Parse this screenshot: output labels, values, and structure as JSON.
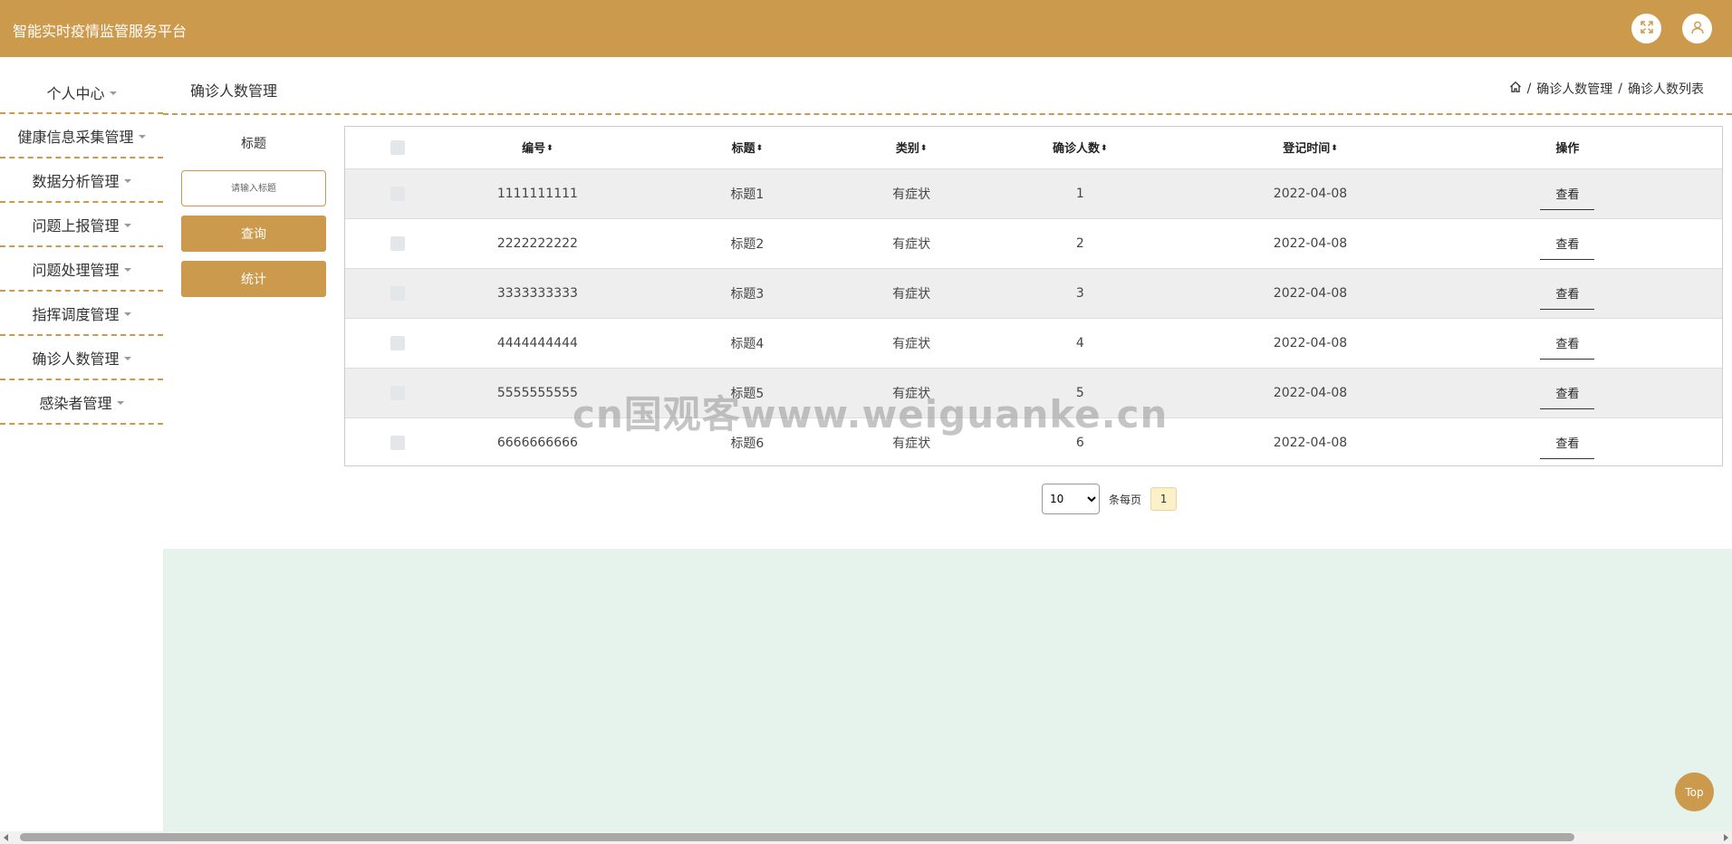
{
  "app": {
    "title": "智能实时疫情监管服务平台"
  },
  "header": {
    "fullscreen_icon": "expand-icon",
    "user_icon": "user-icon"
  },
  "sidebar": {
    "items": [
      {
        "label": "个人中心"
      },
      {
        "label": "健康信息采集管理"
      },
      {
        "label": "数据分析管理"
      },
      {
        "label": "问题上报管理"
      },
      {
        "label": "问题处理管理"
      },
      {
        "label": "指挥调度管理"
      },
      {
        "label": "确诊人数管理"
      },
      {
        "label": "感染者管理"
      }
    ]
  },
  "page": {
    "title": "确诊人数管理"
  },
  "breadcrumb": {
    "home_icon": "home-icon",
    "items": [
      "确诊人数管理",
      "确诊人数列表"
    ],
    "separator": "/"
  },
  "search": {
    "label": "标题",
    "placeholder": "请输入标题",
    "query_button": "查询",
    "stats_button": "统计"
  },
  "table": {
    "columns": [
      "编号",
      "标题",
      "类别",
      "确诊人数",
      "登记时间",
      "操作"
    ],
    "rows": [
      {
        "id": "1111111111",
        "title": "标题1",
        "category": "有症状",
        "count": "1",
        "date": "2022-04-08",
        "action": "查看"
      },
      {
        "id": "2222222222",
        "title": "标题2",
        "category": "有症状",
        "count": "2",
        "date": "2022-04-08",
        "action": "查看"
      },
      {
        "id": "3333333333",
        "title": "标题3",
        "category": "有症状",
        "count": "3",
        "date": "2022-04-08",
        "action": "查看"
      },
      {
        "id": "4444444444",
        "title": "标题4",
        "category": "有症状",
        "count": "4",
        "date": "2022-04-08",
        "action": "查看"
      },
      {
        "id": "5555555555",
        "title": "标题5",
        "category": "有症状",
        "count": "5",
        "date": "2022-04-08",
        "action": "查看"
      },
      {
        "id": "6666666666",
        "title": "标题6",
        "category": "有症状",
        "count": "6",
        "date": "2022-04-08",
        "action": "查看"
      }
    ]
  },
  "pager": {
    "page_size": "10",
    "page_size_options": [
      "10"
    ],
    "per_page_label": "条每页",
    "current_page": "1"
  },
  "watermark": "cn国观客www.weiguanke.cn",
  "top_button": "Top",
  "colors": {
    "brand": "#cc9a4c",
    "green_area": "#e5f3ec",
    "row_alt": "#eeeeee"
  }
}
